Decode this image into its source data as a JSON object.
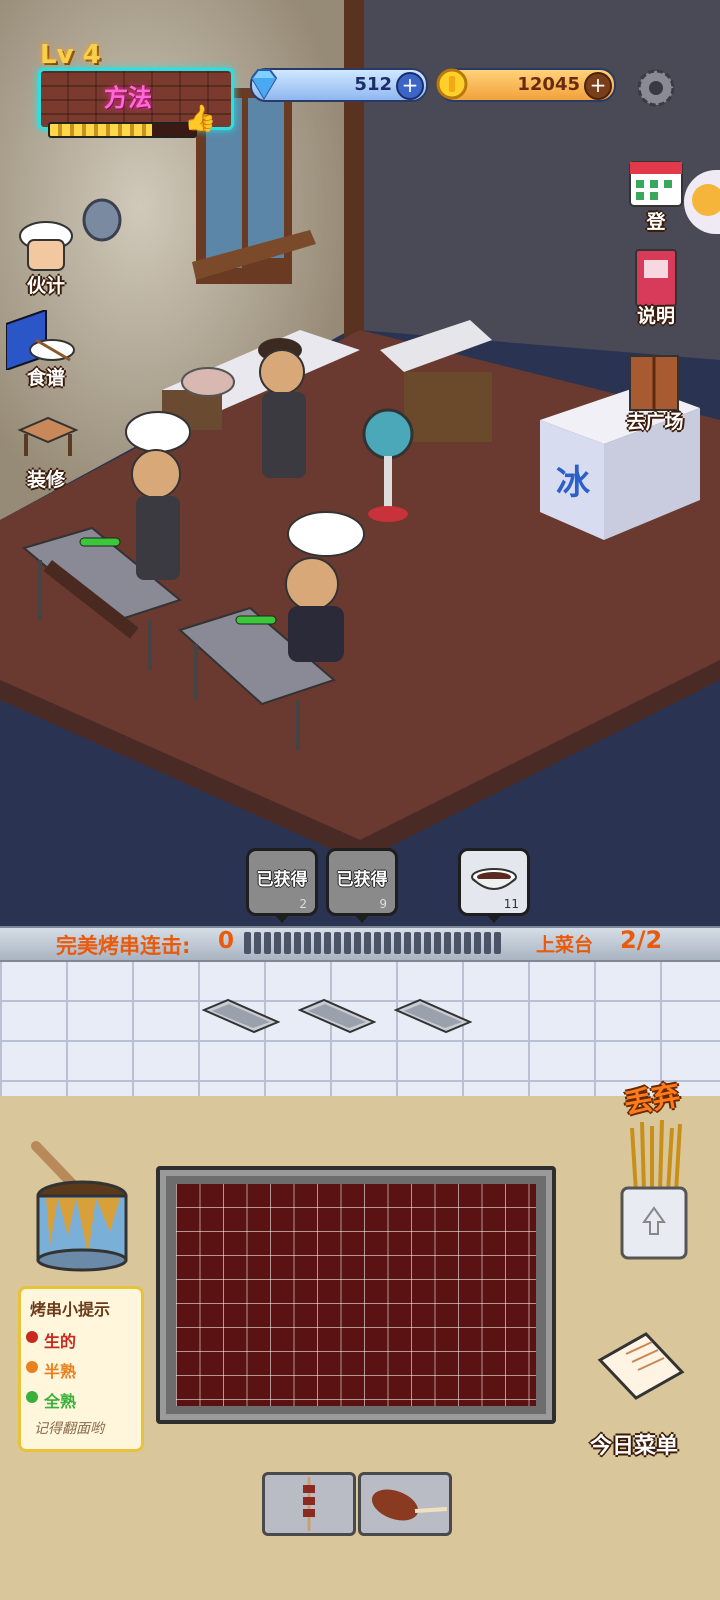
{
  "hud": {
    "level": "Lv 4",
    "dish_name": "方法",
    "level_progress": 0.7,
    "gems": "512",
    "coins": "12045"
  },
  "side_left": [
    {
      "label": "伙计",
      "icon": "chef-hat-icon"
    },
    {
      "label": "食谱",
      "icon": "recipe-book-icon"
    },
    {
      "label": "装修",
      "icon": "table-icon"
    }
  ],
  "side_right": [
    {
      "label": "登",
      "icon": "calendar-icon"
    },
    {
      "label": "说明",
      "icon": "book-icon"
    },
    {
      "label": "去广场",
      "icon": "door-icon"
    }
  ],
  "scene": {
    "freezer_label": "冰"
  },
  "orders": [
    {
      "text": "已获得",
      "count": "2"
    },
    {
      "text": "已获得",
      "count": "9"
    },
    {
      "text": "",
      "count": "11"
    }
  ],
  "combo": {
    "label": "完美烤串连击:",
    "value": "0",
    "counter_label": "上菜台",
    "counter_value": "2/2"
  },
  "tips": {
    "title": "烤串小提示",
    "raw": "生的",
    "half": "半熟",
    "done": "全熟",
    "footer": "记得翻面哟"
  },
  "bottom": {
    "discard": "丢弃",
    "menu": "今日菜单"
  },
  "colors": {
    "raw": "#c8281e",
    "half": "#e8801e",
    "done": "#3ab03a",
    "accent_orange": "#e85a0e"
  }
}
